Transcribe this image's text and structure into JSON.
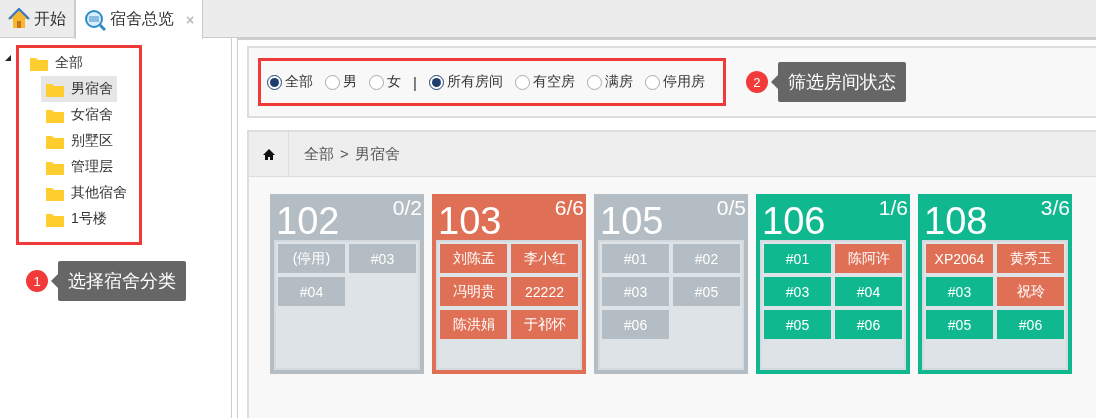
{
  "tabs": [
    {
      "label": "开始",
      "selected": false
    },
    {
      "label": "宿舍总览",
      "selected": true,
      "close": "×"
    }
  ],
  "tree": {
    "label": "全部",
    "expanded": true,
    "children": [
      {
        "label": "男宿舍",
        "selected": true
      },
      {
        "label": "女宿舍",
        "selected": false
      },
      {
        "label": "别墅区",
        "selected": false
      },
      {
        "label": "管理层",
        "selected": false
      },
      {
        "label": "其他宿舍",
        "selected": false
      },
      {
        "label": "1号楼",
        "selected": false
      }
    ]
  },
  "tree_callout": {
    "badge": "1",
    "text": "选择宿舍分类"
  },
  "filter": {
    "separator": "|",
    "groups": [
      {
        "options": [
          {
            "label": "全部",
            "selected": true
          },
          {
            "label": "男",
            "selected": false
          },
          {
            "label": "女",
            "selected": false
          }
        ]
      },
      {
        "options": [
          {
            "label": "所有房间",
            "selected": true
          },
          {
            "label": "有空房",
            "selected": false
          },
          {
            "label": "满房",
            "selected": false
          },
          {
            "label": "停用房",
            "selected": false
          }
        ]
      }
    ]
  },
  "filter_callout": {
    "badge": "2",
    "text": "筛选房间状态"
  },
  "breadcrumb": {
    "parts": [
      "全部",
      ">",
      "男宿舍"
    ]
  },
  "rooms": [
    {
      "number": "102",
      "count": "0/2",
      "color": "#b3bdc3",
      "beds": [
        {
          "label": "(停用)",
          "color": "#b3bdc3"
        },
        {
          "label": "#03",
          "color": "#b3bdc3"
        },
        {
          "label": "#04",
          "color": "#b3bdc3"
        }
      ]
    },
    {
      "number": "103",
      "count": "6/6",
      "color": "#e07055",
      "beds": [
        {
          "label": "刘陈孟",
          "color": "#e07055"
        },
        {
          "label": "李小红",
          "color": "#e07055"
        },
        {
          "label": "冯明贵",
          "color": "#e07055"
        },
        {
          "label": "22222",
          "color": "#e07055"
        },
        {
          "label": "陈洪娟",
          "color": "#e07055"
        },
        {
          "label": "于祁怀",
          "color": "#e07055"
        }
      ]
    },
    {
      "number": "105",
      "count": "0/5",
      "color": "#b3bdc3",
      "beds": [
        {
          "label": "#01",
          "color": "#b3bdc3"
        },
        {
          "label": "#02",
          "color": "#b3bdc3"
        },
        {
          "label": "#03",
          "color": "#b3bdc3"
        },
        {
          "label": "#05",
          "color": "#b3bdc3"
        },
        {
          "label": "#06",
          "color": "#b3bdc3"
        }
      ]
    },
    {
      "number": "106",
      "count": "1/6",
      "color": "#10b890",
      "beds": [
        {
          "label": "#01",
          "color": "#10b890"
        },
        {
          "label": "陈阿许",
          "color": "#e07055"
        },
        {
          "label": "#03",
          "color": "#10b890"
        },
        {
          "label": "#04",
          "color": "#10b890"
        },
        {
          "label": "#05",
          "color": "#10b890"
        },
        {
          "label": "#06",
          "color": "#10b890"
        }
      ]
    },
    {
      "number": "108",
      "count": "3/6",
      "color": "#10b890",
      "beds": [
        {
          "label": "XP2064",
          "color": "#e07055"
        },
        {
          "label": "黄秀玉",
          "color": "#e07055"
        },
        {
          "label": "#03",
          "color": "#10b890"
        },
        {
          "label": "祝玲",
          "color": "#e07055"
        },
        {
          "label": "#05",
          "color": "#10b890"
        },
        {
          "label": "#06",
          "color": "#10b890"
        }
      ]
    }
  ]
}
